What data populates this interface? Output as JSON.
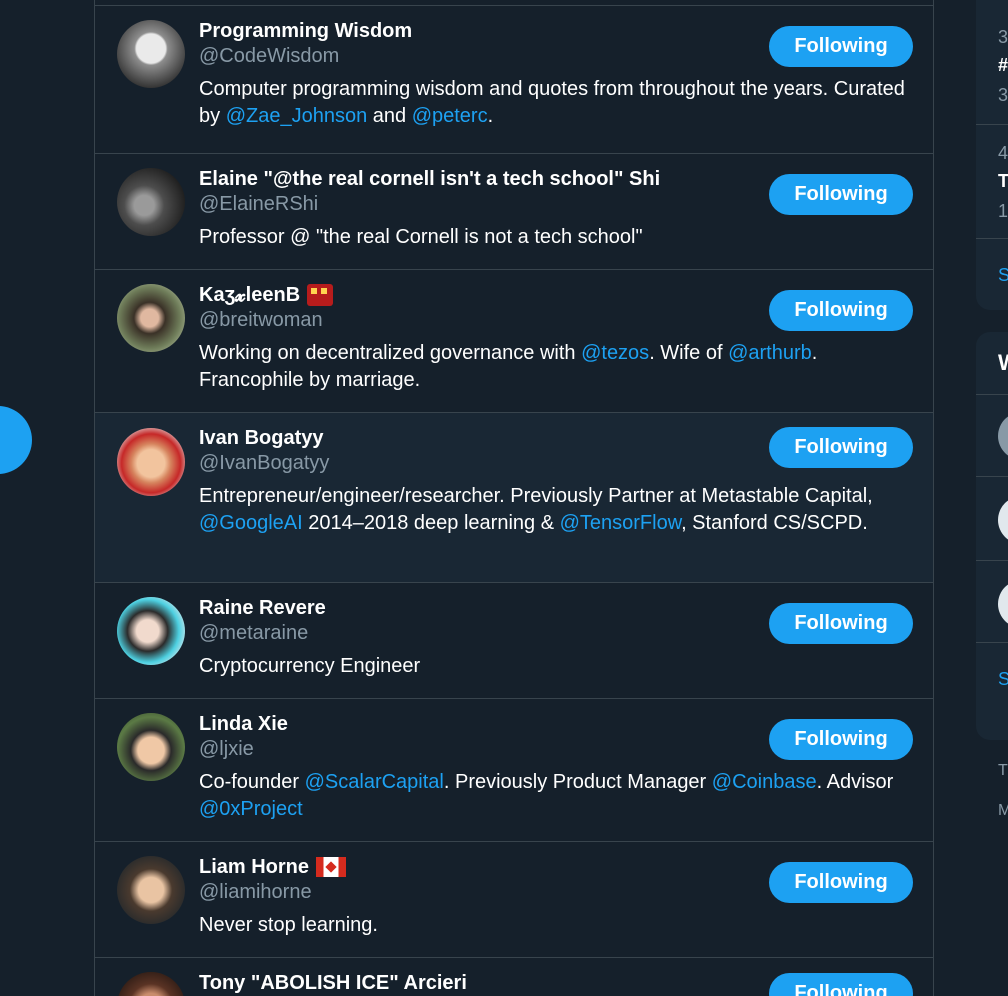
{
  "accounts": [
    {
      "name": "Programming Wisdom",
      "handle": "@CodeWisdom",
      "bio": [
        "Computer programming wisdom and quotes from throughout the years. Curated by ",
        "@Zae_Johnson",
        " and ",
        "@peterc",
        "."
      ],
      "button": "Following"
    },
    {
      "name": "Elaine \"@the real cornell isn't a tech school\" Shi",
      "handle": "@ElaineRShi",
      "bio": "Professor @ \"the real Cornell is not a tech school\"",
      "button": "Following"
    },
    {
      "name": "Kaʒ𝔁leenB",
      "name_text": "KatzleenB",
      "emoji": "train-icon",
      "handle": "@breitwoman",
      "bio": [
        "Working on decentralized governance with ",
        "@tezos",
        ". Wife of ",
        "@arthurb",
        ". Francophile by marriage."
      ],
      "button": "Following"
    },
    {
      "name": "Ivan Bogatyy",
      "handle": "@IvanBogatyy",
      "bio": [
        "Entrepreneur/engineer/researcher. Previously Partner at Metastable Capital, ",
        "@GoogleAI",
        " 2014–2018 deep learning & ",
        "@TensorFlow",
        ", Stanford CS/SCPD."
      ],
      "button": "Following"
    },
    {
      "name": "Raine Revere",
      "handle": "@metaraine",
      "bio": "Cryptocurrency Engineer",
      "button": "Following"
    },
    {
      "name": "Linda Xie",
      "handle": "@ljxie",
      "bio": [
        "Co-founder ",
        "@ScalarCapital",
        ". Previously Product Manager ",
        "@Coinbase",
        ". Advisor ",
        "@0xProject"
      ],
      "button": "Following"
    },
    {
      "name": "Liam Horne",
      "emoji": "canada-flag-icon",
      "handle": "@liamihorne",
      "bio": "Never stop learning.",
      "button": "Following"
    },
    {
      "name": "Tony \"ABOLISH ICE\" Arcieri",
      "button": "Following"
    }
  ],
  "right_sidebar": {
    "trend1_rank": "3",
    "trend1_title": "#",
    "trend1_count": "3",
    "trend2_rank": "4",
    "trend2_title": "T",
    "trend2_count": "1",
    "show_more_1": "S",
    "who_to_follow_initial": "W",
    "show_more_2": "S",
    "footer_line1": "T",
    "footer_line2": "M"
  },
  "colors": {
    "background": "#15202b",
    "highlight": "#192734",
    "accent": "#1da1f2",
    "muted": "#8899a6",
    "border": "#38444d"
  }
}
